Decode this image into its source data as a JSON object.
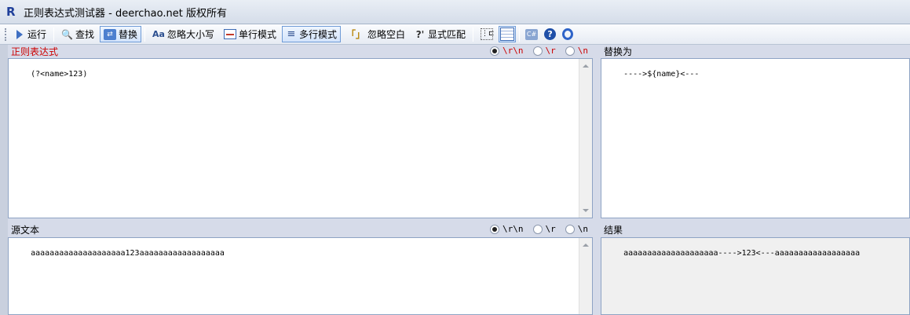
{
  "window": {
    "logo": "R",
    "title": "正则表达式测试器 - deerchao.net 版权所有"
  },
  "toolbar": {
    "run": "运行",
    "find": "查找",
    "replace": "替换",
    "ignore_case": "忽略大小写",
    "single_line": "单行模式",
    "multi_line": "多行模式",
    "ignore_whitespace": "忽略空白",
    "explicit_capture": "显式匹配",
    "icons": {
      "case": "Aa",
      "space": "「」",
      "explicit": "?'",
      "tree": "⋮⊏",
      "cs": "C#",
      "help": "?"
    }
  },
  "regex_panel": {
    "label": "正则表达式",
    "value": "(?<name>123)",
    "newline_options": [
      "\\r\\n",
      "\\r",
      "\\n"
    ],
    "selected": "\\r\\n"
  },
  "replace_panel": {
    "label": "替换为",
    "value": "---->${name}<---"
  },
  "source_panel": {
    "label": "源文本",
    "value": "aaaaaaaaaaaaaaaaaaaa123aaaaaaaaaaaaaaaaaa",
    "newline_options": [
      "\\r\\n",
      "\\r",
      "\\n"
    ],
    "selected": "\\r\\n"
  },
  "result_panel": {
    "label": "结果",
    "value": "aaaaaaaaaaaaaaaaaaaa---->123<---aaaaaaaaaaaaaaaaaa"
  },
  "colors": {
    "accent": "#cc0000",
    "selection_border": "#6f9bd6"
  }
}
